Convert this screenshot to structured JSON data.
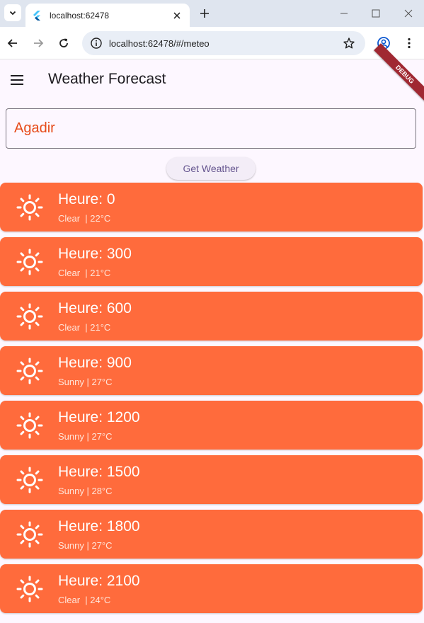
{
  "browser": {
    "tab_title": "localhost:62478",
    "url": "localhost:62478/#/meteo"
  },
  "app": {
    "title": "Weather Forecast",
    "debug_banner": "DEBUG",
    "city_value": "Agadir",
    "button_label": "Get Weather",
    "accent_color": "#ff6b3c"
  },
  "forecast": [
    {
      "title": "Heure: 0",
      "subtitle": "Clear  | 22°C",
      "icon": "sun-icon"
    },
    {
      "title": "Heure: 300",
      "subtitle": "Clear  | 21°C",
      "icon": "sun-icon"
    },
    {
      "title": "Heure: 600",
      "subtitle": "Clear  | 21°C",
      "icon": "sun-icon"
    },
    {
      "title": "Heure: 900",
      "subtitle": "Sunny | 27°C",
      "icon": "sun-icon"
    },
    {
      "title": "Heure: 1200",
      "subtitle": "Sunny | 27°C",
      "icon": "sun-icon"
    },
    {
      "title": "Heure: 1500",
      "subtitle": "Sunny | 28°C",
      "icon": "sun-icon"
    },
    {
      "title": "Heure: 1800",
      "subtitle": "Sunny | 27°C",
      "icon": "sun-icon"
    },
    {
      "title": "Heure: 2100",
      "subtitle": "Clear  | 24°C",
      "icon": "sun-icon"
    }
  ]
}
